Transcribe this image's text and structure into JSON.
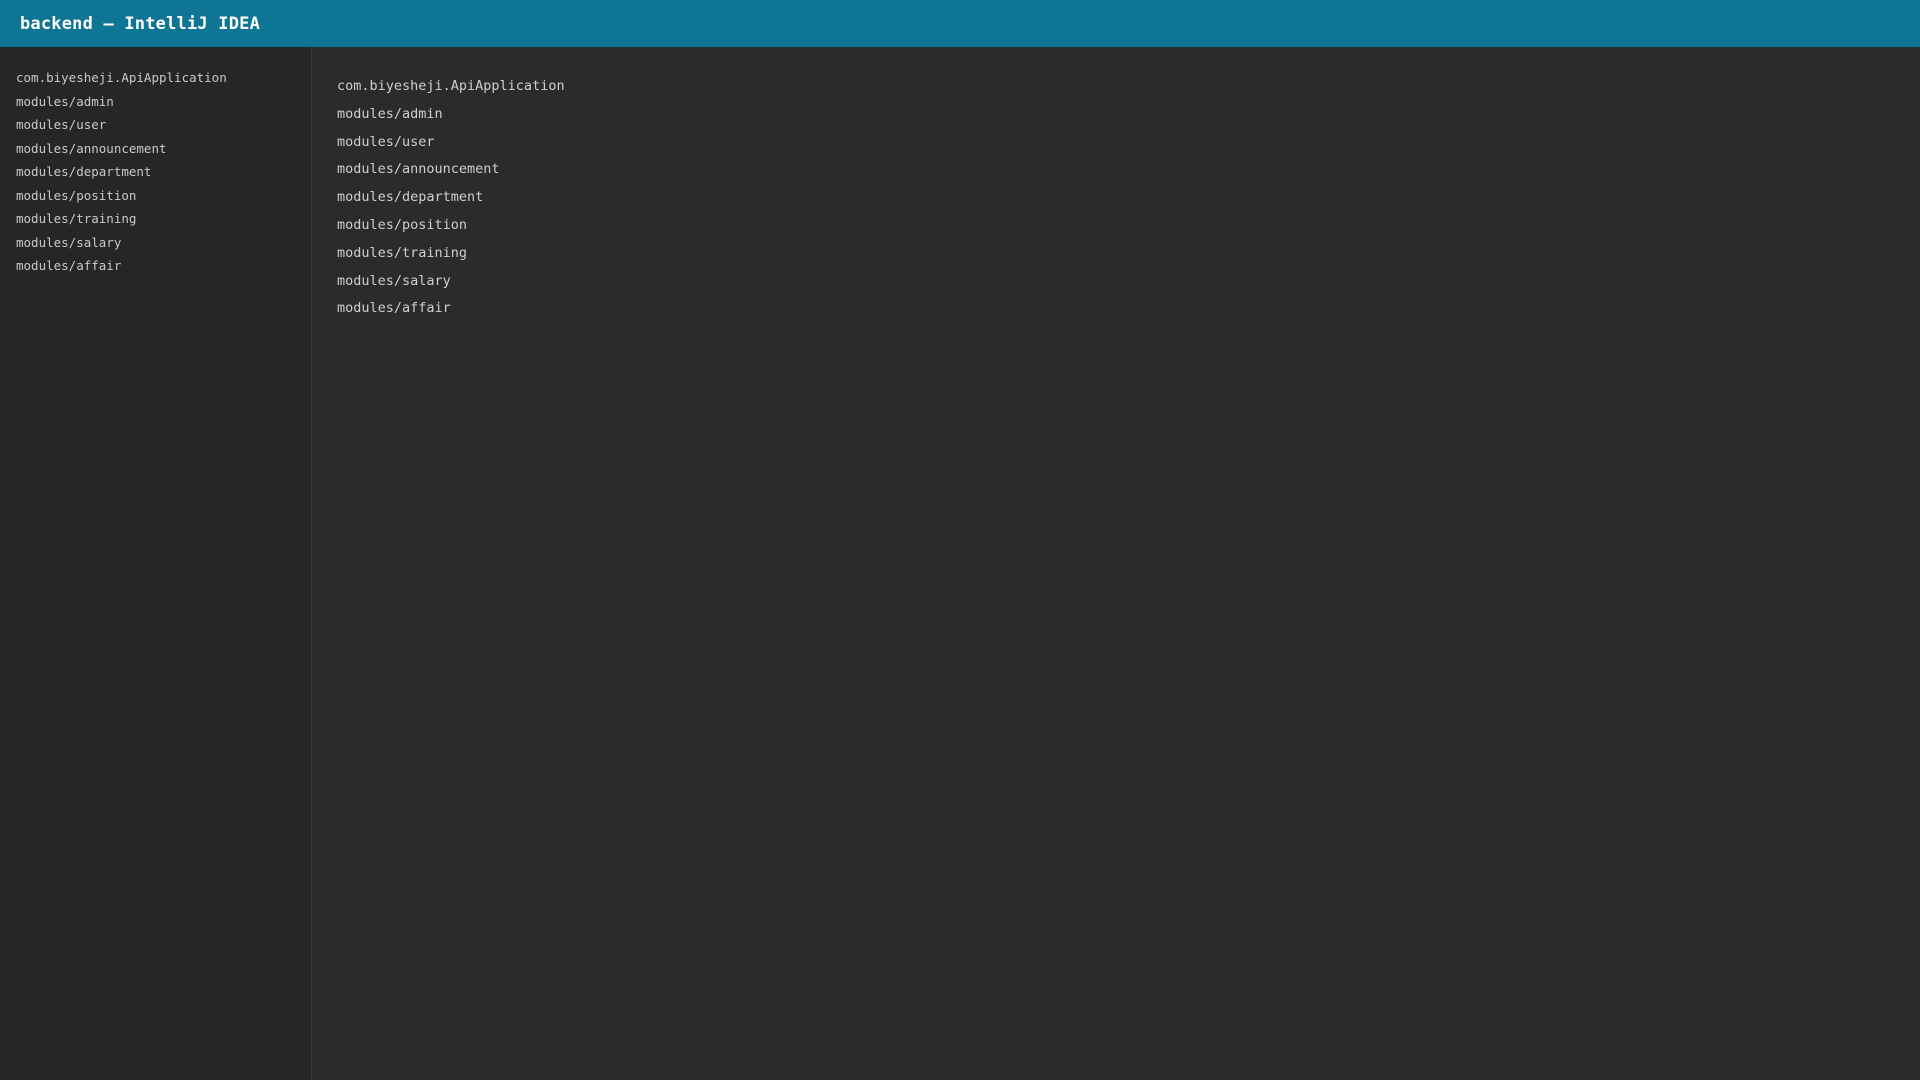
{
  "window": {
    "title": "backend — IntelliJ IDEA"
  },
  "sidebar": {
    "items": [
      {
        "label": "com.biyesheji.ApiApplication"
      },
      {
        "label": "modules/admin"
      },
      {
        "label": "modules/user"
      },
      {
        "label": "modules/announcement"
      },
      {
        "label": "modules/department"
      },
      {
        "label": "modules/position"
      },
      {
        "label": "modules/training"
      },
      {
        "label": "modules/salary"
      },
      {
        "label": "modules/affair"
      }
    ]
  },
  "editor": {
    "lines": [
      {
        "text": "com.biyesheji.ApiApplication"
      },
      {
        "text": "modules/admin"
      },
      {
        "text": "modules/user"
      },
      {
        "text": "modules/announcement"
      },
      {
        "text": "modules/department"
      },
      {
        "text": "modules/position"
      },
      {
        "text": "modules/training"
      },
      {
        "text": "modules/salary"
      },
      {
        "text": "modules/affair"
      }
    ]
  },
  "colors": {
    "titlebar": "#0e7594",
    "sidebar_bg": "#262626",
    "editor_bg": "#2b2b2b",
    "text": "#cfcfcf"
  }
}
